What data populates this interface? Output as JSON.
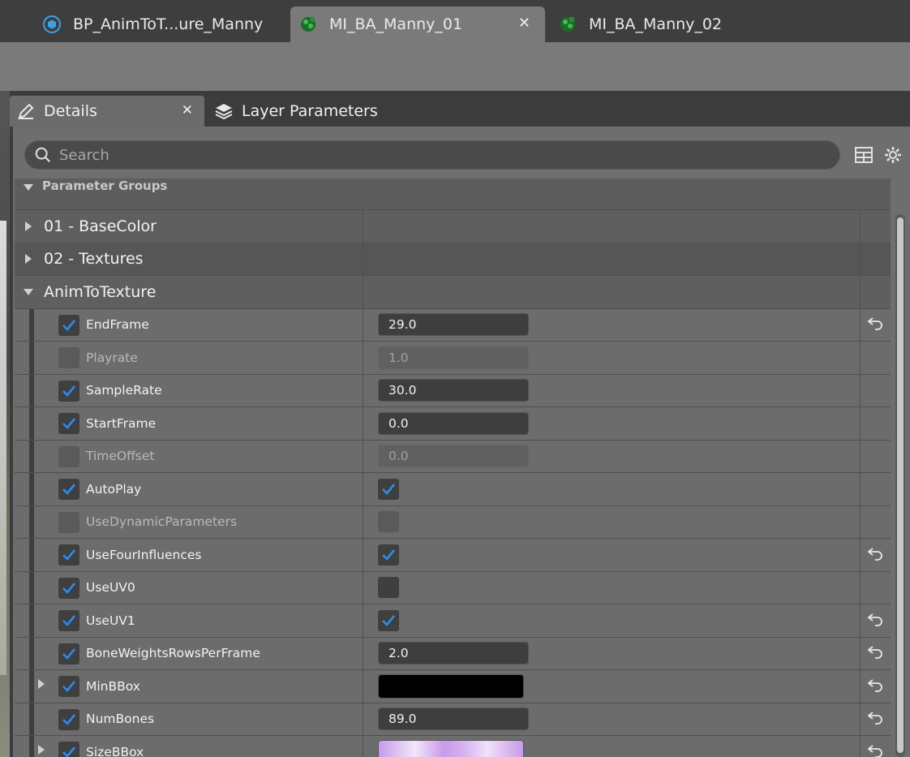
{
  "doc_tabs": [
    {
      "label": "BP_AnimToT...ure_Manny",
      "icon": "blueprint-icon",
      "active": false
    },
    {
      "label": "MI_BA_Manny_01",
      "icon": "material-instance-icon",
      "active": true,
      "close": "✕"
    },
    {
      "label": "MI_BA_Manny_02",
      "icon": "material-instance-icon",
      "active": false
    }
  ],
  "panel_tabs": [
    {
      "label": "Details",
      "icon": "pencil-icon",
      "active": true,
      "close": "✕"
    },
    {
      "label": "Layer Parameters",
      "icon": "layers-icon",
      "active": false
    }
  ],
  "search": {
    "placeholder": "Search",
    "value": ""
  },
  "toolbar_icons": [
    "table-icon",
    "gear-icon"
  ],
  "grid": {
    "header": "Parameter Groups",
    "categories": [
      {
        "label": "01 - BaseColor",
        "expanded": false
      },
      {
        "label": "02 - Textures",
        "expanded": false
      },
      {
        "label": "AnimToTexture",
        "expanded": true
      }
    ],
    "properties": [
      {
        "name": "EndFrame",
        "enabled": true,
        "type": "number",
        "value": "29.0",
        "reset": true
      },
      {
        "name": "Playrate",
        "enabled": false,
        "type": "number",
        "value": "1.0",
        "reset": false
      },
      {
        "name": "SampleRate",
        "enabled": true,
        "type": "number",
        "value": "30.0",
        "reset": false
      },
      {
        "name": "StartFrame",
        "enabled": true,
        "type": "number",
        "value": "0.0",
        "reset": false
      },
      {
        "name": "TimeOffset",
        "enabled": false,
        "type": "number",
        "value": "0.0",
        "reset": false
      },
      {
        "name": "AutoPlay",
        "enabled": true,
        "type": "bool",
        "checked": true,
        "reset": false
      },
      {
        "name": "UseDynamicParameters",
        "enabled": false,
        "type": "bool",
        "checked": false,
        "reset": false
      },
      {
        "name": "UseFourInfluences",
        "enabled": true,
        "type": "bool",
        "checked": true,
        "reset": true
      },
      {
        "name": "UseUV0",
        "enabled": true,
        "type": "bool",
        "checked": false,
        "reset": false
      },
      {
        "name": "UseUV1",
        "enabled": true,
        "type": "bool",
        "checked": true,
        "reset": true
      },
      {
        "name": "BoneWeightsRowsPerFrame",
        "enabled": true,
        "type": "number",
        "value": "2.0",
        "reset": true
      },
      {
        "name": "MinBBox",
        "enabled": true,
        "type": "color",
        "color": "#000000",
        "expandable": true,
        "reset": true
      },
      {
        "name": "NumBones",
        "enabled": true,
        "type": "number",
        "value": "89.0",
        "reset": true
      },
      {
        "name": "SizeBBox",
        "enabled": true,
        "type": "color",
        "color": "#c79be8",
        "expandable": true,
        "reset": true
      }
    ]
  },
  "colors": {
    "accent_check": "#2d8cf0",
    "panel_bg": "#6e6e6e",
    "tab_active": "#7a7a7a"
  }
}
